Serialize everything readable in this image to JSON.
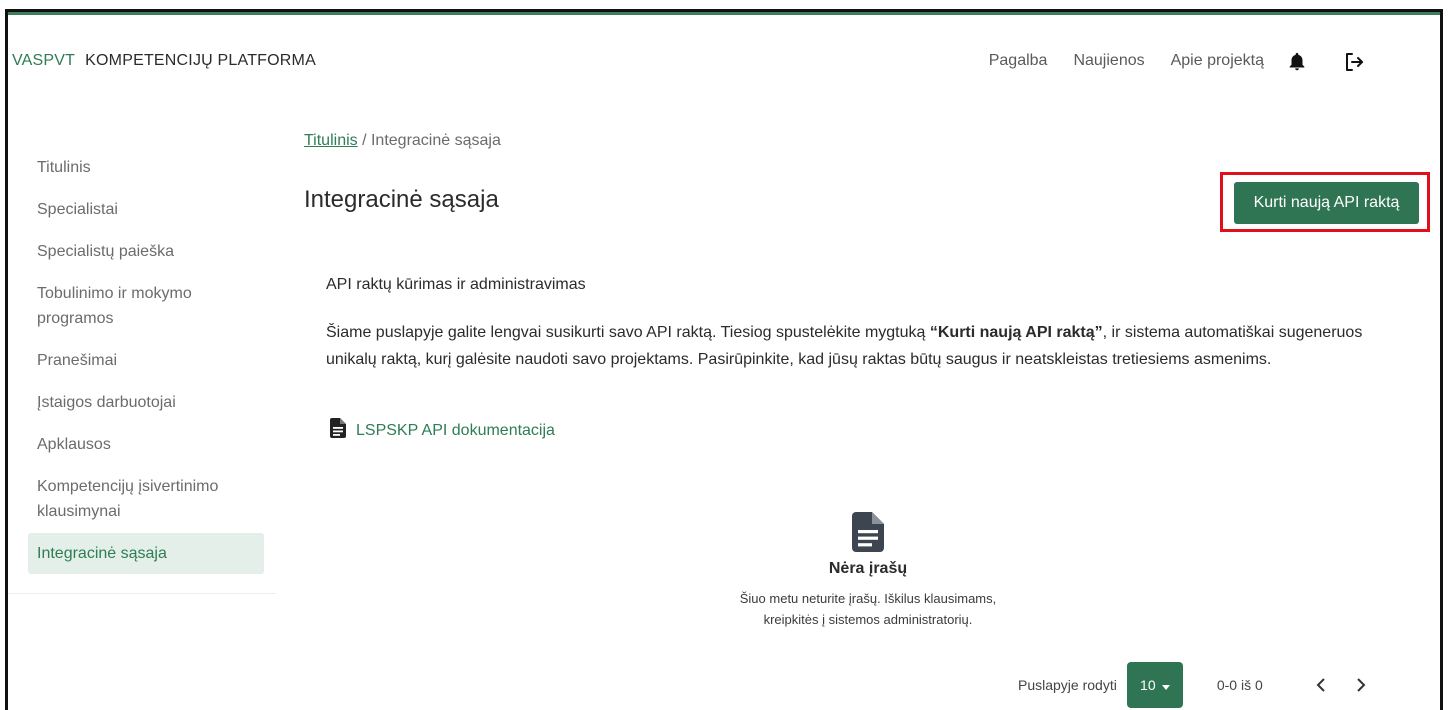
{
  "header": {
    "brand": "VASPVT",
    "platform": "KOMPETENCIJŲ PLATFORMA",
    "nav": [
      "Pagalba",
      "Naujienos",
      "Apie projektą"
    ],
    "icons": [
      "bell-icon",
      "logout-icon"
    ]
  },
  "sidebar": {
    "items": [
      {
        "label": "Titulinis"
      },
      {
        "label": "Specialistai"
      },
      {
        "label": "Specialistų paieška"
      },
      {
        "label": "Tobulinimo ir mokymo programos"
      },
      {
        "label": "Pranešimai"
      },
      {
        "label": "Įstaigos darbuotojai"
      },
      {
        "label": "Apklausos"
      },
      {
        "label": "Kompetencijų įsivertinimo klausimynai"
      },
      {
        "label": "Integracinė sąsaja"
      }
    ],
    "active_index": 8
  },
  "breadcrumb": {
    "home": "Titulinis",
    "separator": " / ",
    "current": "Integracinė sąsaja"
  },
  "main": {
    "title": "Integracinė sąsaja",
    "create_button": "Kurti naują API raktą",
    "subtitle": "API raktų kūrimas ir administravimas",
    "description_prefix": "Šiame puslapyje galite lengvai susikurti savo API raktą. Tiesiog spustelėkite mygtuką ",
    "description_bold": "“Kurti naują API raktą”",
    "description_suffix": ", ir sistema automatiškai sugeneruos unikalų raktą, kurį galėsite naudoti savo projektams. Pasirūpinkite, kad jūsų raktas būtų saugus ir neatskleistas tretiesiems asmenims.",
    "doc_link": "LSPSKP API dokumentacija"
  },
  "empty_state": {
    "title": "Nėra įrašų",
    "line1": "Šiuo metu neturite įrašų. Iškilus klausimams,",
    "line2": "kreipkitės į sistemos administratorių."
  },
  "pagination": {
    "label": "Puslapyje rodyti",
    "page_size": "10",
    "range": "0-0 iš 0"
  },
  "colors": {
    "accent": "#2f7553",
    "highlight_border": "#e0101a",
    "active_bg": "#e3efe8"
  }
}
